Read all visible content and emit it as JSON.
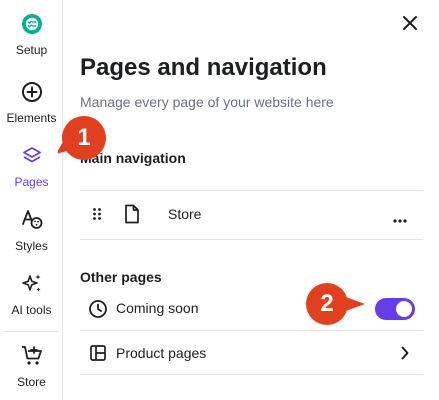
{
  "sidebar": {
    "items": [
      {
        "label": "Setup",
        "icon": "setup-checklist-icon"
      },
      {
        "label": "Elements",
        "icon": "plus-circle-icon"
      },
      {
        "label": "Pages",
        "icon": "layers-icon",
        "active": true
      },
      {
        "label": "Styles",
        "icon": "styles-palette-icon"
      },
      {
        "label": "AI tools",
        "icon": "ai-sparkle-icon"
      },
      {
        "label": "Store",
        "icon": "cart-plus-icon"
      }
    ]
  },
  "panel": {
    "title": "Pages and navigation",
    "subtitle": "Manage every page of your website here"
  },
  "main_navigation": {
    "heading": "Main navigation",
    "items": [
      {
        "label": "Store"
      }
    ]
  },
  "other_pages": {
    "heading": "Other pages",
    "items": [
      {
        "label": "Coming soon",
        "toggle_on": true
      },
      {
        "label": "Product pages"
      }
    ]
  },
  "badges": [
    "1",
    "2"
  ],
  "colors": {
    "accent": "#673de6",
    "badge": "#e0401f",
    "text": "#1d1e20",
    "muted": "#6d7081",
    "setup_icon": "#00b090"
  }
}
